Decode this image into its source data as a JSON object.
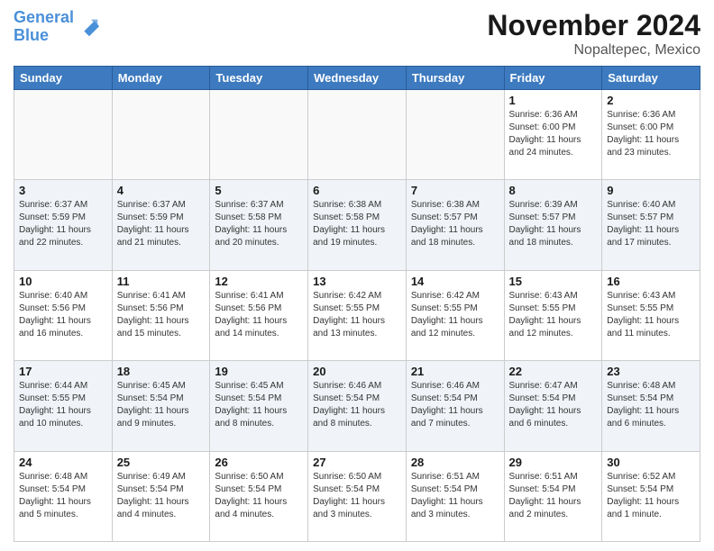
{
  "header": {
    "logo_line1": "General",
    "logo_line2": "Blue",
    "month": "November 2024",
    "location": "Nopaltepec, Mexico"
  },
  "weekdays": [
    "Sunday",
    "Monday",
    "Tuesday",
    "Wednesday",
    "Thursday",
    "Friday",
    "Saturday"
  ],
  "weeks": [
    [
      {
        "day": "",
        "info": ""
      },
      {
        "day": "",
        "info": ""
      },
      {
        "day": "",
        "info": ""
      },
      {
        "day": "",
        "info": ""
      },
      {
        "day": "",
        "info": ""
      },
      {
        "day": "1",
        "info": "Sunrise: 6:36 AM\nSunset: 6:00 PM\nDaylight: 11 hours and 24 minutes."
      },
      {
        "day": "2",
        "info": "Sunrise: 6:36 AM\nSunset: 6:00 PM\nDaylight: 11 hours and 23 minutes."
      }
    ],
    [
      {
        "day": "3",
        "info": "Sunrise: 6:37 AM\nSunset: 5:59 PM\nDaylight: 11 hours and 22 minutes."
      },
      {
        "day": "4",
        "info": "Sunrise: 6:37 AM\nSunset: 5:59 PM\nDaylight: 11 hours and 21 minutes."
      },
      {
        "day": "5",
        "info": "Sunrise: 6:37 AM\nSunset: 5:58 PM\nDaylight: 11 hours and 20 minutes."
      },
      {
        "day": "6",
        "info": "Sunrise: 6:38 AM\nSunset: 5:58 PM\nDaylight: 11 hours and 19 minutes."
      },
      {
        "day": "7",
        "info": "Sunrise: 6:38 AM\nSunset: 5:57 PM\nDaylight: 11 hours and 18 minutes."
      },
      {
        "day": "8",
        "info": "Sunrise: 6:39 AM\nSunset: 5:57 PM\nDaylight: 11 hours and 18 minutes."
      },
      {
        "day": "9",
        "info": "Sunrise: 6:40 AM\nSunset: 5:57 PM\nDaylight: 11 hours and 17 minutes."
      }
    ],
    [
      {
        "day": "10",
        "info": "Sunrise: 6:40 AM\nSunset: 5:56 PM\nDaylight: 11 hours and 16 minutes."
      },
      {
        "day": "11",
        "info": "Sunrise: 6:41 AM\nSunset: 5:56 PM\nDaylight: 11 hours and 15 minutes."
      },
      {
        "day": "12",
        "info": "Sunrise: 6:41 AM\nSunset: 5:56 PM\nDaylight: 11 hours and 14 minutes."
      },
      {
        "day": "13",
        "info": "Sunrise: 6:42 AM\nSunset: 5:55 PM\nDaylight: 11 hours and 13 minutes."
      },
      {
        "day": "14",
        "info": "Sunrise: 6:42 AM\nSunset: 5:55 PM\nDaylight: 11 hours and 12 minutes."
      },
      {
        "day": "15",
        "info": "Sunrise: 6:43 AM\nSunset: 5:55 PM\nDaylight: 11 hours and 12 minutes."
      },
      {
        "day": "16",
        "info": "Sunrise: 6:43 AM\nSunset: 5:55 PM\nDaylight: 11 hours and 11 minutes."
      }
    ],
    [
      {
        "day": "17",
        "info": "Sunrise: 6:44 AM\nSunset: 5:55 PM\nDaylight: 11 hours and 10 minutes."
      },
      {
        "day": "18",
        "info": "Sunrise: 6:45 AM\nSunset: 5:54 PM\nDaylight: 11 hours and 9 minutes."
      },
      {
        "day": "19",
        "info": "Sunrise: 6:45 AM\nSunset: 5:54 PM\nDaylight: 11 hours and 8 minutes."
      },
      {
        "day": "20",
        "info": "Sunrise: 6:46 AM\nSunset: 5:54 PM\nDaylight: 11 hours and 8 minutes."
      },
      {
        "day": "21",
        "info": "Sunrise: 6:46 AM\nSunset: 5:54 PM\nDaylight: 11 hours and 7 minutes."
      },
      {
        "day": "22",
        "info": "Sunrise: 6:47 AM\nSunset: 5:54 PM\nDaylight: 11 hours and 6 minutes."
      },
      {
        "day": "23",
        "info": "Sunrise: 6:48 AM\nSunset: 5:54 PM\nDaylight: 11 hours and 6 minutes."
      }
    ],
    [
      {
        "day": "24",
        "info": "Sunrise: 6:48 AM\nSunset: 5:54 PM\nDaylight: 11 hours and 5 minutes."
      },
      {
        "day": "25",
        "info": "Sunrise: 6:49 AM\nSunset: 5:54 PM\nDaylight: 11 hours and 4 minutes."
      },
      {
        "day": "26",
        "info": "Sunrise: 6:50 AM\nSunset: 5:54 PM\nDaylight: 11 hours and 4 minutes."
      },
      {
        "day": "27",
        "info": "Sunrise: 6:50 AM\nSunset: 5:54 PM\nDaylight: 11 hours and 3 minutes."
      },
      {
        "day": "28",
        "info": "Sunrise: 6:51 AM\nSunset: 5:54 PM\nDaylight: 11 hours and 3 minutes."
      },
      {
        "day": "29",
        "info": "Sunrise: 6:51 AM\nSunset: 5:54 PM\nDaylight: 11 hours and 2 minutes."
      },
      {
        "day": "30",
        "info": "Sunrise: 6:52 AM\nSunset: 5:54 PM\nDaylight: 11 hours and 1 minute."
      }
    ]
  ]
}
